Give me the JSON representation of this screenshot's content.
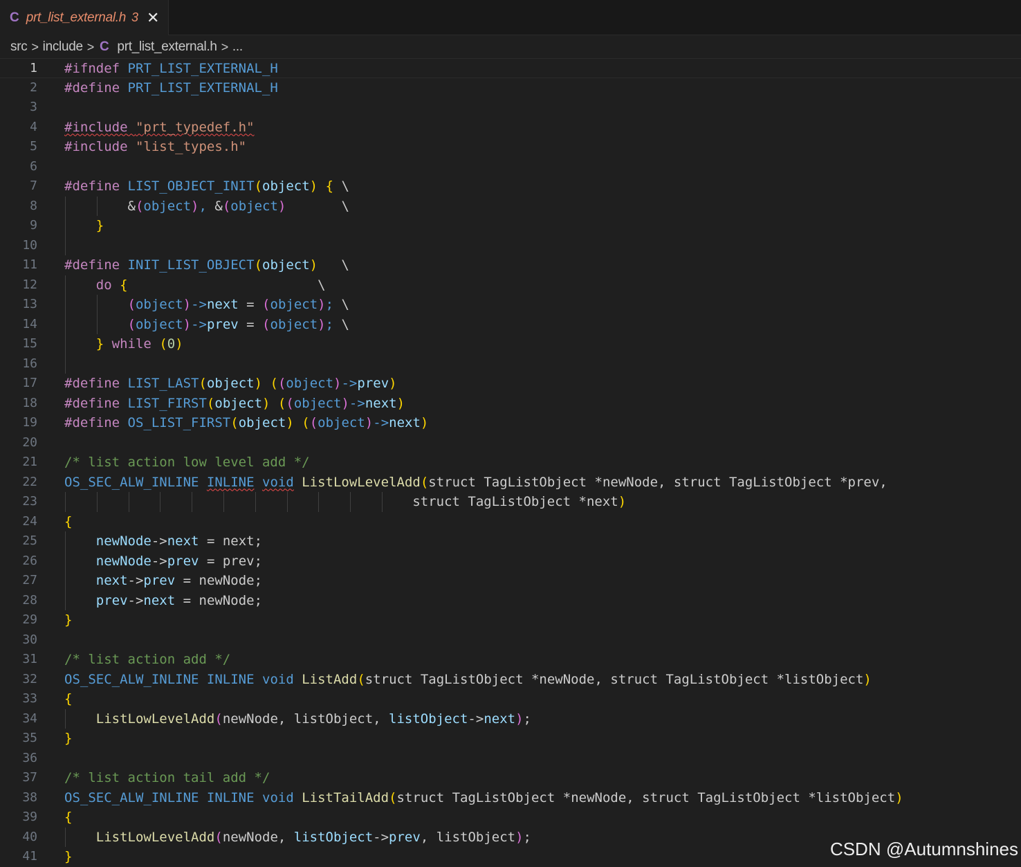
{
  "tab": {
    "icon": "C",
    "title": "prt_list_external.h",
    "problem_count": "3",
    "close_glyph": "✕"
  },
  "breadcrumb": {
    "items": [
      "src",
      "include",
      "prt_list_external.h",
      "..."
    ],
    "file_icon": "C",
    "separator": ">"
  },
  "editor": {
    "active_line": 1,
    "colors": {
      "background": "#1f1f1f",
      "keyword": "#c586c0",
      "macro": "#569cd6",
      "function": "#dcdcaa",
      "string": "#ce9178",
      "comment": "#6a9955",
      "bracket_level1": "#ffd700",
      "bracket_level2": "#da70d6",
      "bracket_level3": "#179fff"
    },
    "lines": [
      {
        "n": "1",
        "tokens": [
          [
            "kw",
            "#ifndef"
          ],
          [
            "pl",
            " "
          ],
          [
            "mac",
            "PRT_LIST_EXTERNAL_H"
          ]
        ]
      },
      {
        "n": "2",
        "tokens": [
          [
            "kw",
            "#define"
          ],
          [
            "pl",
            " "
          ],
          [
            "mac",
            "PRT_LIST_EXTERNAL_H"
          ]
        ]
      },
      {
        "n": "3",
        "tokens": []
      },
      {
        "n": "4",
        "tokens": [
          [
            "kw squiggle",
            "#include"
          ],
          [
            "pl squiggle",
            " "
          ],
          [
            "str squiggle",
            "\"prt_typedef.h\""
          ]
        ]
      },
      {
        "n": "5",
        "tokens": [
          [
            "kw",
            "#include"
          ],
          [
            "pl",
            " "
          ],
          [
            "str",
            "\"list_types.h\""
          ]
        ]
      },
      {
        "n": "6",
        "tokens": []
      },
      {
        "n": "7",
        "tokens": [
          [
            "kw",
            "#define"
          ],
          [
            "pl",
            " "
          ],
          [
            "mac",
            "LIST_OBJECT_INIT"
          ],
          [
            "b1",
            "("
          ],
          [
            "pr",
            "object"
          ],
          [
            "b1",
            ")"
          ],
          [
            "pl",
            " "
          ],
          [
            "b1",
            "{"
          ],
          [
            "pl",
            " \\"
          ]
        ]
      },
      {
        "n": "8",
        "tokens": [
          [
            "pl",
            "        &"
          ],
          [
            "b2",
            "("
          ],
          [
            "mac",
            "object"
          ],
          [
            "b2",
            ")"
          ],
          [
            "mac",
            ","
          ],
          [
            "pl",
            " &"
          ],
          [
            "b2",
            "("
          ],
          [
            "mac",
            "object"
          ],
          [
            "b2",
            ")"
          ],
          [
            "pl",
            "       \\"
          ]
        ]
      },
      {
        "n": "9",
        "tokens": [
          [
            "pl",
            "    "
          ],
          [
            "b1",
            "}"
          ]
        ]
      },
      {
        "n": "10",
        "tokens": []
      },
      {
        "n": "11",
        "tokens": [
          [
            "kw",
            "#define"
          ],
          [
            "pl",
            " "
          ],
          [
            "mac",
            "INIT_LIST_OBJECT"
          ],
          [
            "b1",
            "("
          ],
          [
            "pr",
            "object"
          ],
          [
            "b1",
            ")"
          ],
          [
            "pl",
            "   \\"
          ]
        ]
      },
      {
        "n": "12",
        "tokens": [
          [
            "pl",
            "    "
          ],
          [
            "kw",
            "do"
          ],
          [
            "pl",
            " "
          ],
          [
            "b1",
            "{"
          ],
          [
            "pl",
            "                        \\"
          ]
        ]
      },
      {
        "n": "13",
        "tokens": [
          [
            "pl",
            "        "
          ],
          [
            "b2",
            "("
          ],
          [
            "mac",
            "object"
          ],
          [
            "b2",
            ")"
          ],
          [
            "mac",
            "->"
          ],
          [
            "pr",
            "next"
          ],
          [
            "pl",
            " = "
          ],
          [
            "b2",
            "("
          ],
          [
            "mac",
            "object"
          ],
          [
            "b2",
            ")"
          ],
          [
            "mac",
            ";"
          ],
          [
            "pl",
            " \\"
          ]
        ]
      },
      {
        "n": "14",
        "tokens": [
          [
            "pl",
            "        "
          ],
          [
            "b2",
            "("
          ],
          [
            "mac",
            "object"
          ],
          [
            "b2",
            ")"
          ],
          [
            "mac",
            "->"
          ],
          [
            "pr",
            "prev"
          ],
          [
            "pl",
            " = "
          ],
          [
            "b2",
            "("
          ],
          [
            "mac",
            "object"
          ],
          [
            "b2",
            ")"
          ],
          [
            "mac",
            ";"
          ],
          [
            "pl",
            " \\"
          ]
        ]
      },
      {
        "n": "15",
        "tokens": [
          [
            "pl",
            "    "
          ],
          [
            "b1",
            "}"
          ],
          [
            "pl",
            " "
          ],
          [
            "kw",
            "while"
          ],
          [
            "pl",
            " "
          ],
          [
            "b1",
            "("
          ],
          [
            "num",
            "0"
          ],
          [
            "b1",
            ")"
          ]
        ]
      },
      {
        "n": "16",
        "tokens": []
      },
      {
        "n": "17",
        "tokens": [
          [
            "kw",
            "#define"
          ],
          [
            "pl",
            " "
          ],
          [
            "mac",
            "LIST_LAST"
          ],
          [
            "b1",
            "("
          ],
          [
            "pr",
            "object"
          ],
          [
            "b1",
            ")"
          ],
          [
            "pl",
            " "
          ],
          [
            "b1",
            "("
          ],
          [
            "b2",
            "("
          ],
          [
            "mac",
            "object"
          ],
          [
            "b2",
            ")"
          ],
          [
            "mac",
            "->"
          ],
          [
            "pr",
            "prev"
          ],
          [
            "b1",
            ")"
          ]
        ]
      },
      {
        "n": "18",
        "tokens": [
          [
            "kw",
            "#define"
          ],
          [
            "pl",
            " "
          ],
          [
            "mac",
            "LIST_FIRST"
          ],
          [
            "b1",
            "("
          ],
          [
            "pr",
            "object"
          ],
          [
            "b1",
            ")"
          ],
          [
            "pl",
            " "
          ],
          [
            "b1",
            "("
          ],
          [
            "b2",
            "("
          ],
          [
            "mac",
            "object"
          ],
          [
            "b2",
            ")"
          ],
          [
            "mac",
            "->"
          ],
          [
            "pr",
            "next"
          ],
          [
            "b1",
            ")"
          ]
        ]
      },
      {
        "n": "19",
        "tokens": [
          [
            "kw",
            "#define"
          ],
          [
            "pl",
            " "
          ],
          [
            "mac",
            "OS_LIST_FIRST"
          ],
          [
            "b1",
            "("
          ],
          [
            "pr",
            "object"
          ],
          [
            "b1",
            ")"
          ],
          [
            "pl",
            " "
          ],
          [
            "b1",
            "("
          ],
          [
            "b2",
            "("
          ],
          [
            "mac",
            "object"
          ],
          [
            "b2",
            ")"
          ],
          [
            "mac",
            "->"
          ],
          [
            "pr",
            "next"
          ],
          [
            "b1",
            ")"
          ]
        ]
      },
      {
        "n": "20",
        "tokens": []
      },
      {
        "n": "21",
        "tokens": [
          [
            "cm",
            "/* list action low level add */"
          ]
        ]
      },
      {
        "n": "22",
        "tokens": [
          [
            "mac",
            "OS_SEC_ALW_INLINE"
          ],
          [
            "pl",
            " "
          ],
          [
            "mac squiggle",
            "INLINE"
          ],
          [
            "pl",
            " "
          ],
          [
            "mac squiggle",
            "void"
          ],
          [
            "pl",
            " "
          ],
          [
            "fn",
            "ListLowLevelAdd"
          ],
          [
            "b1",
            "("
          ],
          [
            "pl",
            "struct TagListObject *newNode, struct TagListObject *prev,"
          ]
        ]
      },
      {
        "n": "23",
        "tokens": [
          [
            "pl",
            "                                            struct TagListObject *next"
          ],
          [
            "b1",
            ")"
          ]
        ]
      },
      {
        "n": "24",
        "tokens": [
          [
            "b1",
            "{"
          ]
        ]
      },
      {
        "n": "25",
        "tokens": [
          [
            "pl",
            "    "
          ],
          [
            "par",
            "newNode"
          ],
          [
            "pl",
            "->"
          ],
          [
            "pr",
            "next"
          ],
          [
            "pl",
            " = next;"
          ]
        ]
      },
      {
        "n": "26",
        "tokens": [
          [
            "pl",
            "    "
          ],
          [
            "par",
            "newNode"
          ],
          [
            "pl",
            "->"
          ],
          [
            "pr",
            "prev"
          ],
          [
            "pl",
            " = prev;"
          ]
        ]
      },
      {
        "n": "27",
        "tokens": [
          [
            "pl",
            "    "
          ],
          [
            "par",
            "next"
          ],
          [
            "pl",
            "->"
          ],
          [
            "pr",
            "prev"
          ],
          [
            "pl",
            " = newNode;"
          ]
        ]
      },
      {
        "n": "28",
        "tokens": [
          [
            "pl",
            "    "
          ],
          [
            "par",
            "prev"
          ],
          [
            "pl",
            "->"
          ],
          [
            "pr",
            "next"
          ],
          [
            "pl",
            " = newNode;"
          ]
        ]
      },
      {
        "n": "29",
        "tokens": [
          [
            "b1",
            "}"
          ]
        ]
      },
      {
        "n": "30",
        "tokens": []
      },
      {
        "n": "31",
        "tokens": [
          [
            "cm",
            "/* list action add */"
          ]
        ]
      },
      {
        "n": "32",
        "tokens": [
          [
            "mac",
            "OS_SEC_ALW_INLINE"
          ],
          [
            "pl",
            " "
          ],
          [
            "mac",
            "INLINE"
          ],
          [
            "pl",
            " "
          ],
          [
            "mac",
            "void"
          ],
          [
            "pl",
            " "
          ],
          [
            "fn",
            "ListAdd"
          ],
          [
            "b1",
            "("
          ],
          [
            "pl",
            "struct TagListObject *newNode, struct TagListObject *listObject"
          ],
          [
            "b1",
            ")"
          ]
        ]
      },
      {
        "n": "33",
        "tokens": [
          [
            "b1",
            "{"
          ]
        ]
      },
      {
        "n": "34",
        "tokens": [
          [
            "pl",
            "    "
          ],
          [
            "fn",
            "ListLowLevelAdd"
          ],
          [
            "b2",
            "("
          ],
          [
            "pl",
            "newNode, listObject, "
          ],
          [
            "par",
            "listObject"
          ],
          [
            "pl",
            "->"
          ],
          [
            "pr",
            "next"
          ],
          [
            "b2",
            ")"
          ],
          [
            "pl",
            ";"
          ]
        ]
      },
      {
        "n": "35",
        "tokens": [
          [
            "b1",
            "}"
          ]
        ]
      },
      {
        "n": "36",
        "tokens": []
      },
      {
        "n": "37",
        "tokens": [
          [
            "cm",
            "/* list action tail add */"
          ]
        ]
      },
      {
        "n": "38",
        "tokens": [
          [
            "mac",
            "OS_SEC_ALW_INLINE"
          ],
          [
            "pl",
            " "
          ],
          [
            "mac",
            "INLINE"
          ],
          [
            "pl",
            " "
          ],
          [
            "mac",
            "void"
          ],
          [
            "pl",
            " "
          ],
          [
            "fn",
            "ListTailAdd"
          ],
          [
            "b1",
            "("
          ],
          [
            "pl",
            "struct TagListObject *newNode, struct TagListObject *listObject"
          ],
          [
            "b1",
            ")"
          ]
        ]
      },
      {
        "n": "39",
        "tokens": [
          [
            "b1",
            "{"
          ]
        ]
      },
      {
        "n": "40",
        "tokens": [
          [
            "pl",
            "    "
          ],
          [
            "fn",
            "ListLowLevelAdd"
          ],
          [
            "b2",
            "("
          ],
          [
            "pl",
            "newNode, "
          ],
          [
            "par",
            "listObject"
          ],
          [
            "pl",
            "->"
          ],
          [
            "pr",
            "prev"
          ],
          [
            "pl",
            ", listObject"
          ],
          [
            "b2",
            ")"
          ],
          [
            "pl",
            ";"
          ]
        ]
      },
      {
        "n": "41",
        "tokens": [
          [
            "b1",
            "}"
          ]
        ]
      }
    ]
  },
  "watermark": "CSDN @Autumnshines"
}
